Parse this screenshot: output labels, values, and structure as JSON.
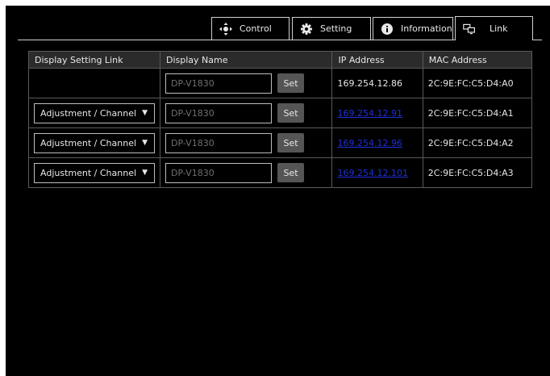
{
  "tabs": {
    "control": {
      "label": "Control",
      "icon": "move-arrows-icon"
    },
    "setting": {
      "label": "Setting",
      "icon": "gear-icon"
    },
    "information": {
      "label": "Information",
      "icon": "info-icon"
    },
    "link": {
      "label": "Link",
      "icon": "linked-displays-icon",
      "active": true
    }
  },
  "table": {
    "headers": {
      "display_setting_link": "Display Setting Link",
      "display_name": "Display Name",
      "ip_address": "IP Address",
      "mac_address": "MAC Address"
    },
    "set_label": "Set",
    "rows": [
      {
        "link_select": "",
        "name_placeholder": "DP-V1830",
        "ip": "169.254.12.86",
        "mac": "2C:9E:FC:C5:D4:A0"
      },
      {
        "link_select": "Adjustment / Channel",
        "name_placeholder": "DP-V1830",
        "ip": "169.254.12.91",
        "mac": "2C:9E:FC:C5:D4:A1"
      },
      {
        "link_select": "Adjustment / Channel",
        "name_placeholder": "DP-V1830",
        "ip": "169.254.12.96",
        "mac": "2C:9E:FC:C5:D4:A2"
      },
      {
        "link_select": "Adjustment / Channel",
        "name_placeholder": "DP-V1830",
        "ip": "169.254.12.101",
        "mac": "2C:9E:FC:C5:D4:A3"
      }
    ]
  },
  "colors": {
    "background": "#000000",
    "link": "#1f2fd6",
    "button": "#555555",
    "header": "#2b2b2b"
  }
}
